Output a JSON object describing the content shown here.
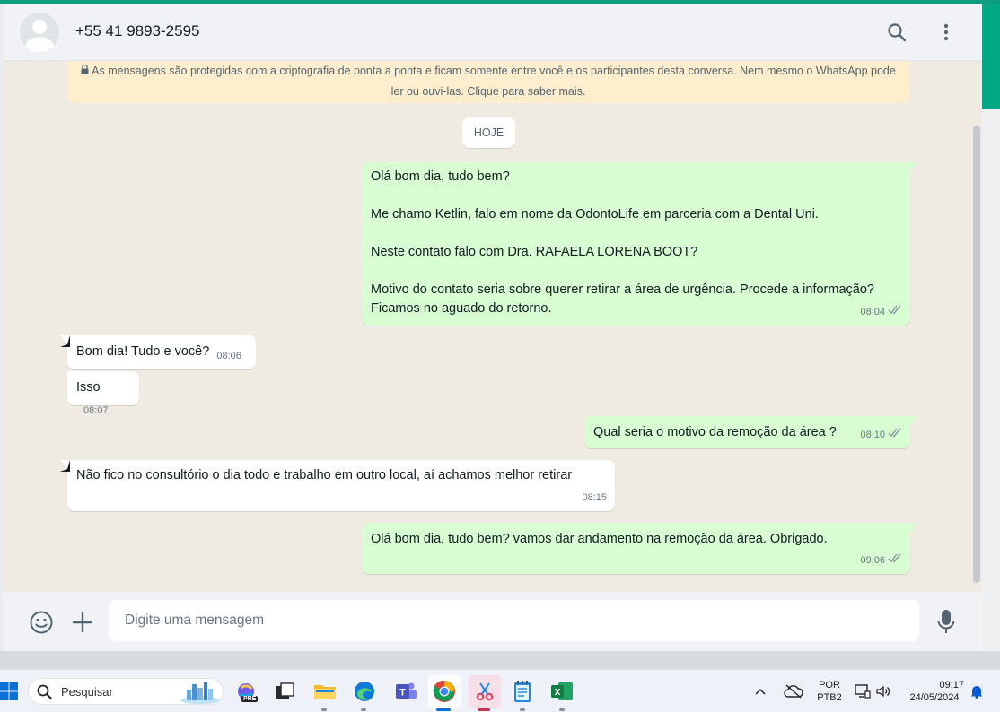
{
  "header": {
    "contact_name": "+55 41 9893-2595"
  },
  "chat": {
    "encryption_notice": "As mensagens são protegidas com a criptografia de ponta a ponta e ficam somente entre você e os participantes desta conversa. Nem mesmo o WhatsApp pode ler ou ouvi-las. Clique para saber mais.",
    "date_chip": "HOJE",
    "messages": [
      {
        "direction": "out",
        "text": "Olá bom dia, tudo bem?\n\nMe chamo Ketlin, falo em nome da OdontoLife em parceria com a Dental Uni.\n\nNeste contato falo com Dra. RAFAELA LORENA BOOT?\n\nMotivo do contato seria sobre querer retirar a área de urgência. Procede a informação? Ficamos no aguado do retorno.",
        "time": "08:04",
        "status": "read"
      },
      {
        "direction": "in",
        "text": "Bom dia! Tudo e você?",
        "time": "08:06"
      },
      {
        "direction": "in",
        "text": "Isso",
        "time": "08:07"
      },
      {
        "direction": "out",
        "text": "Qual seria o motivo da remoção da área ?",
        "time": "08:10",
        "status": "read"
      },
      {
        "direction": "in",
        "text": "Não fico no consultório o dia todo e trabalho em outro local, aí achamos melhor retirar",
        "time": "08:15"
      },
      {
        "direction": "out",
        "text": "Olá bom dia, tudo bem? vamos dar andamento na remoção da área. Obrigado.",
        "time": "09:06",
        "status": "read"
      }
    ]
  },
  "composer": {
    "placeholder": "Digite uma mensagem"
  },
  "taskbar": {
    "search_label": "Pesquisar",
    "language_line1": "POR",
    "language_line2": "PTB2",
    "clock_time": "09:17",
    "clock_date": "24/05/2024",
    "copilot_badge": "PRE"
  },
  "colors": {
    "accent": "#00a884",
    "outgoing_bubble": "#d9fdd3",
    "incoming_bubble": "#ffffff",
    "chat_background": "#efeae2",
    "read_ticks": "#53bdeb"
  }
}
